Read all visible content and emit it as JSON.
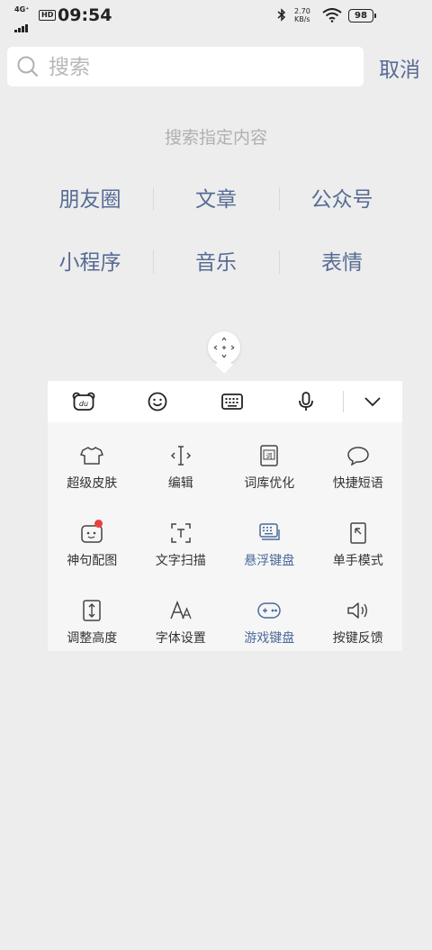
{
  "status": {
    "network": "4G⁺",
    "hd": "HD",
    "time": "09:54",
    "speed_value": "2.70",
    "speed_unit": "KB/s",
    "battery": "98"
  },
  "search": {
    "placeholder": "搜索",
    "cancel": "取消"
  },
  "hint": "搜索指定内容",
  "categories": [
    [
      "朋友圈",
      "文章",
      "公众号"
    ],
    [
      "小程序",
      "音乐",
      "表情"
    ]
  ],
  "keyboard": {
    "toolbar": [
      "bear-logo-icon",
      "emoji-icon",
      "keyboard-icon",
      "microphone-icon",
      "chevron-down-icon"
    ],
    "grid": [
      [
        {
          "label": "超级皮肤",
          "icon": "tshirt-icon"
        },
        {
          "label": "编辑",
          "icon": "text-cursor-icon"
        },
        {
          "label": "词库优化",
          "icon": "dictionary-icon"
        },
        {
          "label": "快捷短语",
          "icon": "speech-bubble-icon"
        }
      ],
      [
        {
          "label": "神句配图",
          "icon": "photo-caption-icon",
          "badge": true
        },
        {
          "label": "文字扫描",
          "icon": "text-scan-icon"
        },
        {
          "label": "悬浮键盘",
          "icon": "floating-keyboard-icon",
          "active": true
        },
        {
          "label": "单手模式",
          "icon": "one-hand-icon"
        }
      ],
      [
        {
          "label": "调整高度",
          "icon": "adjust-height-icon"
        },
        {
          "label": "字体设置",
          "icon": "font-icon"
        },
        {
          "label": "游戏键盘",
          "icon": "gamepad-icon",
          "active": true
        },
        {
          "label": "按键反馈",
          "icon": "speaker-icon"
        }
      ]
    ]
  },
  "colors": {
    "accent": "#576b95",
    "badge": "#e64340"
  }
}
